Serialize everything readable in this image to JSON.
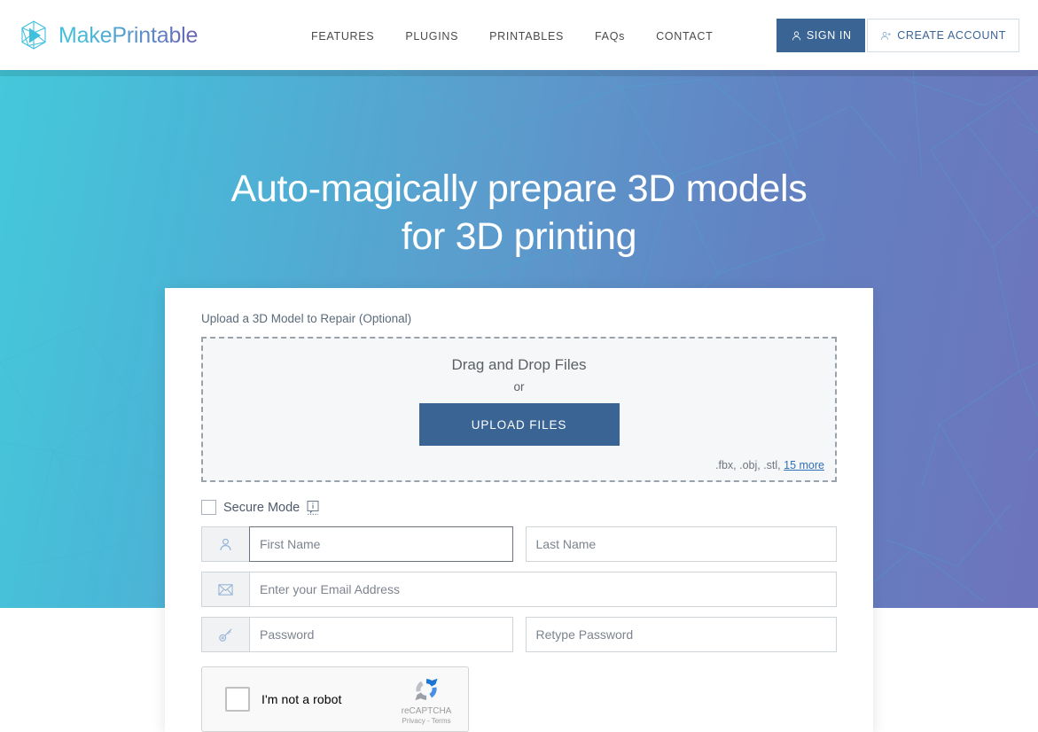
{
  "header": {
    "brand": "MakePrintable",
    "logo_icon": "hexagon-play-icon",
    "nav": [
      {
        "label": "FEATURES",
        "name": "features"
      },
      {
        "label": "PLUGINS",
        "name": "plugins"
      },
      {
        "label": "PRINTABLES",
        "name": "printables"
      },
      {
        "label": "FAQs",
        "name": "faqs"
      },
      {
        "label": "CONTACT",
        "name": "contact"
      }
    ],
    "sign_in": {
      "label": "SIGN IN",
      "icon": "user-icon"
    },
    "create_account": {
      "label": "CREATE ACCOUNT",
      "icon": "user-plus-icon"
    }
  },
  "hero": {
    "title_line1": "Auto-magically prepare 3D models",
    "title_line2": "for 3D printing",
    "gradient_from": "#45c8da",
    "gradient_to": "#6d74bb"
  },
  "card": {
    "upload_label": "Upload a 3D Model to Repair (Optional)",
    "dropzone": {
      "title": "Drag and Drop Files",
      "or": "or",
      "button": "UPLOAD FILES",
      "formats": ".fbx, .obj, .stl,",
      "more_link": "15 more"
    },
    "secure_mode": {
      "label": "Secure Mode",
      "checked": false,
      "info_icon": "info-tooltip-icon"
    },
    "fields": {
      "first_name": {
        "placeholder": "First Name",
        "value": "",
        "icon": "user-icon",
        "focused": true
      },
      "last_name": {
        "placeholder": "Last Name",
        "value": ""
      },
      "email": {
        "placeholder": "Enter your Email Address",
        "value": "",
        "icon": "envelope-icon"
      },
      "password": {
        "placeholder": "Password",
        "value": "",
        "icon": "key-icon"
      },
      "retype_password": {
        "placeholder": "Retype Password",
        "value": ""
      }
    },
    "recaptcha": {
      "label": "I'm not a robot",
      "brand": "reCAPTCHA",
      "terms": "Privacy - Terms",
      "checked": false
    }
  },
  "colors": {
    "primary_button": "#3a6494",
    "link": "#2f6fb5",
    "accent_cyan": "#45c8da",
    "accent_purple": "#6d74bb"
  }
}
